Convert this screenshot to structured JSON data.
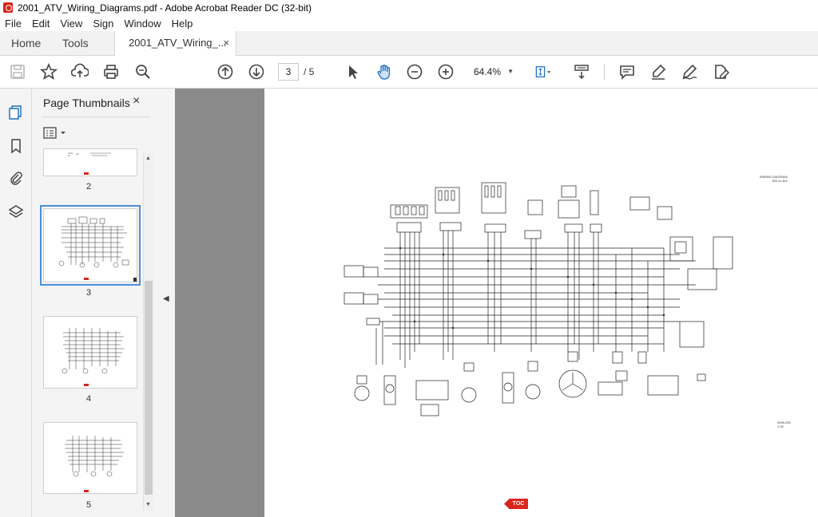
{
  "window": {
    "title": "2001_ATV_Wiring_Diagrams.pdf - Adobe Acrobat Reader DC (32-bit)"
  },
  "menu": [
    "File",
    "Edit",
    "View",
    "Sign",
    "Window",
    "Help"
  ],
  "tabs": {
    "home": "Home",
    "tools": "Tools",
    "document": "2001_ATV_Wiring_...",
    "close": "×"
  },
  "toolbar": {
    "page_current": "3",
    "page_total": "/  5",
    "zoom": "64.4%",
    "icons": [
      "save-icon",
      "bookmark-star-icon",
      "upload-icon",
      "print-icon",
      "search-zoom-icon",
      "prev-page-icon",
      "next-page-icon",
      "select-cursor-icon",
      "hand-tool-icon",
      "zoom-out-icon",
      "zoom-in-icon",
      "fit-page-icon",
      "scroll-mode-icon",
      "comment-icon",
      "highlight-icon",
      "sign-icon",
      "fill-sign-icon"
    ]
  },
  "thumbnails": {
    "title": "Page Thumbnails",
    "close": "×",
    "pages": [
      "2",
      "3",
      "4",
      "5"
    ]
  },
  "document": {
    "diagram_title": "WIRING DIAGRAM",
    "diagram_subtitle": "300 cc 4x4",
    "diagram_code": "0495-000",
    "diagram_rev": "1.00",
    "toc_label": "TOC"
  },
  "colors": {
    "accent_red": "#d8261c",
    "selection_blue": "#4a90d9",
    "doc_bg": "#8a8a8a"
  }
}
